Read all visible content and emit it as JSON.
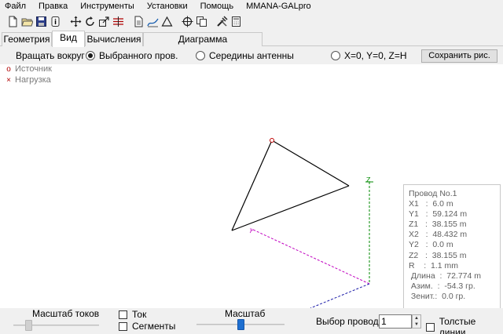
{
  "menu": [
    "Файл",
    "Правка",
    "Инструменты",
    "Установки",
    "Помощь",
    "MMANA-GALpro"
  ],
  "toolbar": {
    "groups": [
      [
        "new-file-icon",
        "open-folder-icon",
        "save-disk-icon",
        "info-icon"
      ],
      [
        "move-icon",
        "rotate-icon",
        "resize-icon",
        "align-icon"
      ],
      [
        "document-icon",
        "curve-edit-icon",
        "triangle-icon"
      ],
      [
        "crosshair-icon",
        "copy-icon"
      ],
      [
        "tools-icon",
        "calculator-icon"
      ]
    ]
  },
  "tabs": [
    {
      "label": "Геометрия",
      "active": false
    },
    {
      "label": "Вид",
      "active": true
    },
    {
      "label": "Вычисления",
      "active": false
    },
    {
      "label": "Диаграмма направленности",
      "active": false
    }
  ],
  "rotate": {
    "label": "Вращать вокруг :",
    "options": [
      {
        "label": "Выбранного пров.",
        "checked": true
      },
      {
        "label": "Середины антенны",
        "checked": false
      },
      {
        "label": "X=0, Y=0, Z=H",
        "checked": false
      }
    ],
    "save_button": "Сохранить рис."
  },
  "legend": {
    "source_mark": "o",
    "source": "Источник",
    "load_mark": "×",
    "load": "Нагрузка"
  },
  "axes": {
    "y_label": "Y",
    "z_label": "Z"
  },
  "wire_info": {
    "title": "Провод No.1",
    "lines": [
      "X1   :  6.0 m",
      "Y1   :  59.124 m",
      "Z1   :  38.155 m",
      "X2   :  48.432 m",
      "Y2   :  0.0 m",
      "Z2   :  38.155 m",
      "R    :  1.1 mm",
      " Длина  :  72.774 m",
      " Азим.  :  -54.3 гр.",
      " Зенит.:  0.0 гр."
    ]
  },
  "bottom": {
    "current_scale_label": "Масштаб токов",
    "current_scale_level": 0.15,
    "current_check": {
      "label": "Ток",
      "checked": false
    },
    "segments_check": {
      "label": "Сегменты",
      "checked": false
    },
    "scale_label": "Масштаб",
    "scale_level": 0.5,
    "wire_select_label": "Выбор провода",
    "wire_select_value": "1",
    "thick_lines_check": {
      "label": "Толстые линии",
      "checked": false
    }
  },
  "colors": {
    "wire": "#000000",
    "x_axis": "#1a1aa8",
    "y_axis": "#c000c0",
    "z_axis": "#008a00",
    "source": "#c00000",
    "scale_thumb": "#1e6fd0"
  }
}
